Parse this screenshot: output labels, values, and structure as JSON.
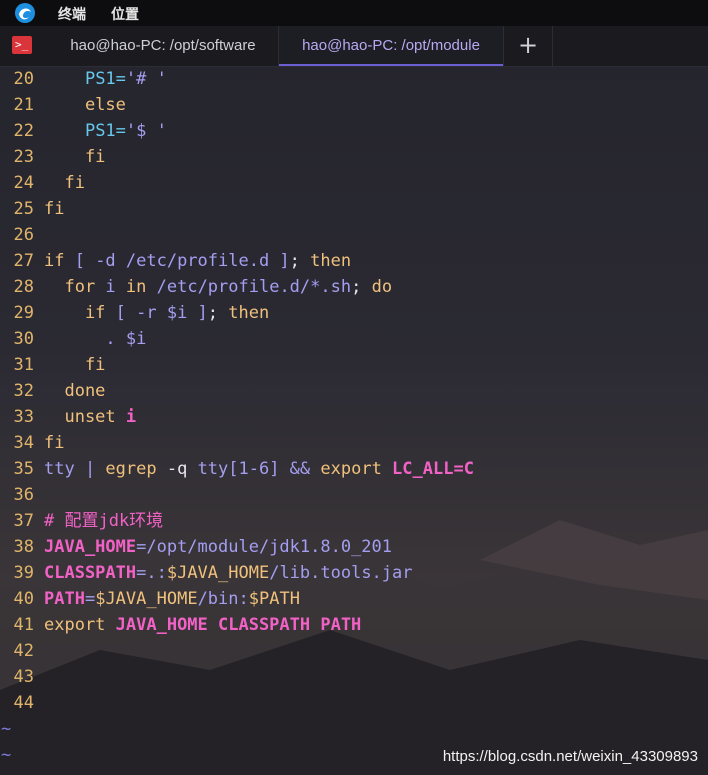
{
  "menubar": {
    "items": [
      "终端",
      "位置"
    ]
  },
  "tabs": [
    {
      "label": "hao@hao-PC: /opt/software",
      "active": false
    },
    {
      "label": "hao@hao-PC: /opt/module",
      "active": true
    }
  ],
  "add_tab_glyph": "+",
  "terminal_icon": "terminal-icon",
  "colors": {
    "line_number": "#e0b56a",
    "keyword": "#f0c17c",
    "path": "#a49ef0",
    "variable_name": "#f262c6",
    "tilde": "#7c7cd8",
    "active_tab": "#b9a9f2"
  },
  "code_lines": [
    {
      "n": "20",
      "text": "      PS1='# '"
    },
    {
      "n": "21",
      "text": "    else"
    },
    {
      "n": "22",
      "text": "      PS1='$ '"
    },
    {
      "n": "23",
      "text": "    fi"
    },
    {
      "n": "24",
      "text": "  fi"
    },
    {
      "n": "25",
      "text": "fi"
    },
    {
      "n": "26",
      "text": ""
    },
    {
      "n": "27",
      "text": "if [ -d /etc/profile.d ]; then"
    },
    {
      "n": "28",
      "text": "  for i in /etc/profile.d/*.sh; do"
    },
    {
      "n": "29",
      "text": "    if [ -r $i ]; then"
    },
    {
      "n": "30",
      "text": "      . $i"
    },
    {
      "n": "31",
      "text": "    fi"
    },
    {
      "n": "32",
      "text": "  done"
    },
    {
      "n": "33",
      "text": "  unset i"
    },
    {
      "n": "34",
      "text": "fi"
    },
    {
      "n": "35",
      "text": "tty | egrep -q tty[1-6] && export LC_ALL=C"
    },
    {
      "n": "36",
      "text": ""
    },
    {
      "n": "37",
      "text": "# 配置jdk环境"
    },
    {
      "n": "38",
      "text": "JAVA_HOME=/opt/module/jdk1.8.0_201"
    },
    {
      "n": "39",
      "text": "CLASSPATH=.:$JAVA_HOME/lib.tools.jar"
    },
    {
      "n": "40",
      "text": "PATH=$JAVA_HOME/bin:$PATH"
    },
    {
      "n": "41",
      "text": "export JAVA_HOME CLASSPATH PATH"
    },
    {
      "n": "42",
      "text": ""
    },
    {
      "n": "43",
      "text": ""
    },
    {
      "n": "44",
      "text": ""
    }
  ],
  "tilde_lines": [
    "~",
    "~"
  ],
  "watermark": "https://blog.csdn.net/weixin_43309893"
}
